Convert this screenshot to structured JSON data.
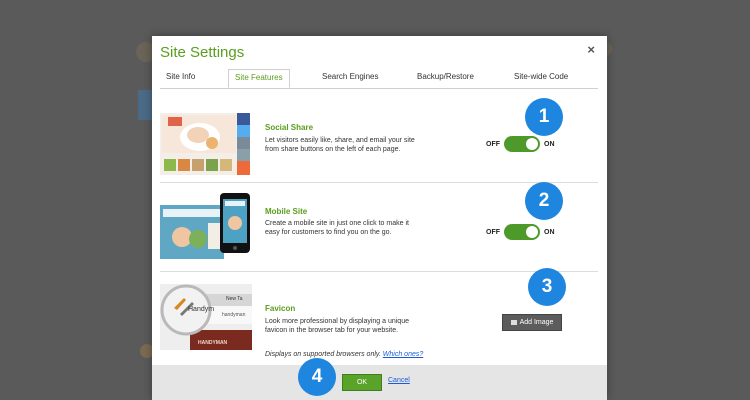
{
  "dialog": {
    "title": "Site Settings",
    "close_icon": "×"
  },
  "tabs": [
    {
      "label": "Site Info"
    },
    {
      "label": "Site Features"
    },
    {
      "label": "Search Engines"
    },
    {
      "label": "Backup/Restore"
    },
    {
      "label": "Site-wide Code"
    }
  ],
  "features": {
    "social_share": {
      "title": "Social Share",
      "description": "Let visitors easily like, share, and email your site from share buttons on the left of each page.",
      "toggle_off": "OFF",
      "toggle_on": "ON"
    },
    "mobile_site": {
      "title": "Mobile Site",
      "description": "Create a mobile site in just one click to make it easy for customers to find you on the go.",
      "toggle_off": "OFF",
      "toggle_on": "ON"
    },
    "favicon": {
      "title": "Favicon",
      "description": "Look more professional by displaying a unique favicon in the browser tab for your website.",
      "note": "Displays on supported browsers only.",
      "note_link": "Which ones?",
      "button": "Add Image",
      "thumb_text": "Handym",
      "thumb_tab": "New Ta",
      "thumb_url": "handyman",
      "thumb_banner": "HANDYMAN"
    }
  },
  "footer": {
    "ok": "OK",
    "cancel": "Cancel"
  },
  "badges": [
    "1",
    "2",
    "3",
    "4"
  ]
}
